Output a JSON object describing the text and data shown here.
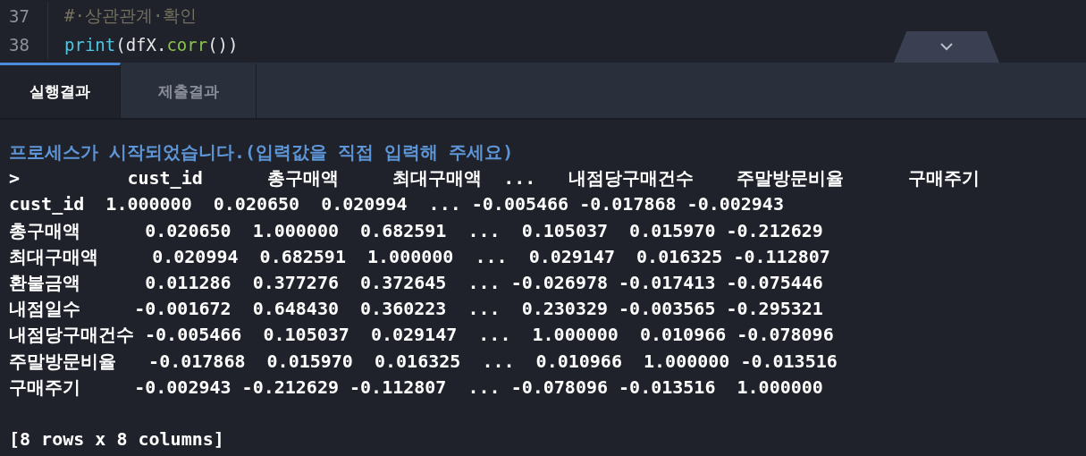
{
  "editor": {
    "lines": [
      {
        "number": "37",
        "tokens": [
          {
            "kind": "comment",
            "text": "#·상관관계·확인"
          }
        ]
      },
      {
        "number": "38",
        "tokens": [
          {
            "kind": "builtin",
            "text": "print"
          },
          {
            "kind": "plain",
            "text": "(dfX."
          },
          {
            "kind": "method",
            "text": "corr"
          },
          {
            "kind": "plain",
            "text": "())"
          }
        ]
      }
    ]
  },
  "tabs": [
    {
      "label": "실행결과",
      "selected": true
    },
    {
      "label": "제출결과",
      "selected": false
    }
  ],
  "console": {
    "lines": [
      {
        "kind": "info",
        "text": "프로세스가 시작되었습니다.(입력값을 직접 입력해 주세요)"
      },
      {
        "kind": "output",
        "text": ">          cust_id      총구매액     최대구매액  ...   내점당구매건수    주말방문비율      구매주기"
      },
      {
        "kind": "output",
        "text": "cust_id  1.000000  0.020650  0.020994  ... -0.005466 -0.017868 -0.002943"
      },
      {
        "kind": "output",
        "text": "총구매액      0.020650  1.000000  0.682591  ...  0.105037  0.015970 -0.212629"
      },
      {
        "kind": "output",
        "text": "최대구매액     0.020994  0.682591  1.000000  ...  0.029147  0.016325 -0.112807"
      },
      {
        "kind": "output",
        "text": "환불금액      0.011286  0.377276  0.372645  ... -0.026978 -0.017413 -0.075446"
      },
      {
        "kind": "output",
        "text": "내점일수     -0.001672  0.648430  0.360223  ...  0.230329 -0.003565 -0.295321"
      },
      {
        "kind": "output",
        "text": "내점당구매건수 -0.005466  0.105037  0.029147  ...  1.000000  0.010966 -0.078096"
      },
      {
        "kind": "output",
        "text": "주말방문비율   -0.017868  0.015970  0.016325  ...  0.010966  1.000000 -0.013516"
      },
      {
        "kind": "output",
        "text": "구매주기     -0.002943 -0.212629 -0.112807  ... -0.078096 -0.013516  1.000000"
      },
      {
        "kind": "summary",
        "text": "[8 rows x 8 columns]"
      }
    ]
  }
}
